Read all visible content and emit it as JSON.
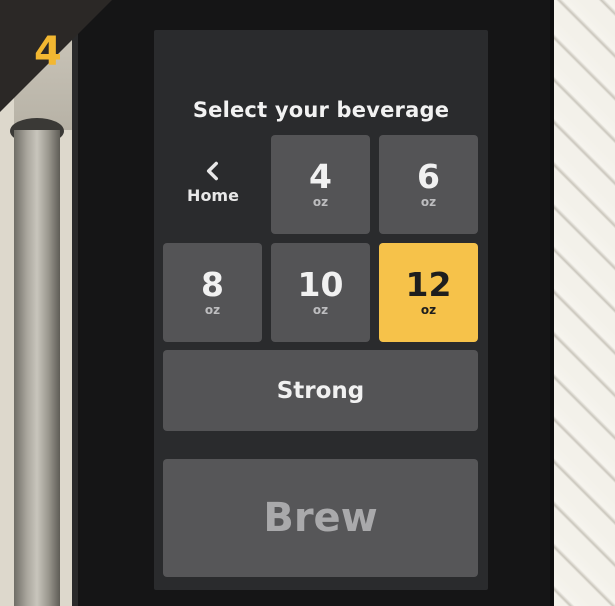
{
  "step": {
    "number": "4"
  },
  "screen": {
    "title": "Select your beverage",
    "home": {
      "label": "Home",
      "icon": "chevron-left-icon"
    },
    "sizes": [
      {
        "value": "4",
        "unit": "oz",
        "selected": false
      },
      {
        "value": "6",
        "unit": "oz",
        "selected": false
      },
      {
        "value": "8",
        "unit": "oz",
        "selected": false
      },
      {
        "value": "10",
        "unit": "oz",
        "selected": false
      },
      {
        "value": "12",
        "unit": "oz",
        "selected": true
      }
    ],
    "strong_label": "Strong",
    "brew_label": "Brew"
  },
  "colors": {
    "accent": "#f6c24a",
    "tile": "#545456",
    "screen": "#2a2b2d",
    "step_number": "#f2b731"
  }
}
